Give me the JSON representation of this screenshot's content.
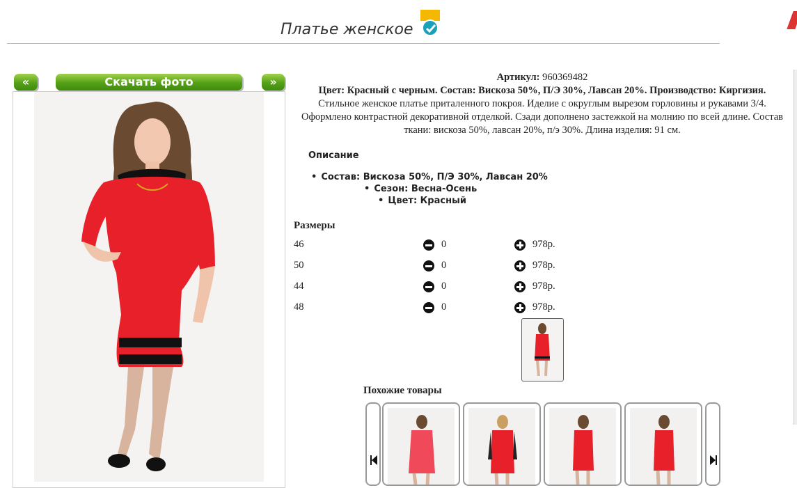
{
  "page": {
    "title": "Платье женское",
    "colors": {
      "button_green": "#55a019",
      "badge_yellow": "#f5b800",
      "badge_teal": "#1aa0b8",
      "dress_red": "#e8202a"
    }
  },
  "gallery": {
    "prev_label": "«",
    "download_label": "Скачать фото",
    "next_label": "»"
  },
  "product": {
    "article_label": "Артикул:",
    "article_value": "960369482",
    "summary": "Цвет: Красный с черным. Состав: Вискоза 50%, П/Э 30%, Лавсан 20%. Производство: Киргизия.",
    "description": "Стильное женское платье приталенного покроя. Иделие с округлым вырезом горловины и рукавами 3/4. Оформлено контрастной декоративной отделкой. Сзади дополнено застежкой на молнию по всей длине. Состав ткани: вискоза 50%, лавсан 20%, п/э 30%. Длина изделия: 91 см.",
    "details_heading": "Описание",
    "details": [
      "Состав: Вискоза 50%, П/Э 30%, Лавсан 20%",
      "Сезон: Весна-Осень",
      "Цвет: Красный"
    ]
  },
  "sizes": {
    "heading": "Размеры",
    "rows": [
      {
        "size": "46",
        "qty": "0",
        "price": "978р."
      },
      {
        "size": "50",
        "qty": "0",
        "price": "978р."
      },
      {
        "size": "44",
        "qty": "0",
        "price": "978р."
      },
      {
        "size": "48",
        "qty": "0",
        "price": "978р."
      }
    ]
  },
  "similar": {
    "heading": "Похожие товары"
  }
}
